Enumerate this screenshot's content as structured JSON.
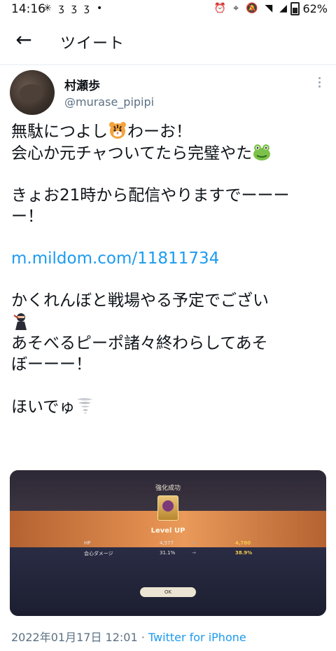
{
  "status_bar": {
    "time": "14:16",
    "battery": "62%",
    "left_icons": [
      "slack-icon",
      "app-icon",
      "app-icon",
      "app-icon",
      "dot-icon"
    ],
    "right_icons": [
      "alarm-icon",
      "location-icon",
      "mute-icon",
      "wifi-icon",
      "signal-icon"
    ]
  },
  "header": {
    "title": "ツイート"
  },
  "tweet": {
    "author_name": "村瀬歩",
    "author_handle": "@murase_pipipi",
    "lines": {
      "l1": "無駄につよし",
      "l1b": "わーお！",
      "l2": "会心か元チャついてたら完璧やた",
      "l3": "きょお21時から配信やりますでーーー",
      "l4": "ー！",
      "link": "m.mildom.com/11811734",
      "l5": "かくれんぼと戦場やる予定でござい",
      "l6": "あそべるピーポ諸々終わらしてあそ",
      "l7": "ぼーーー！",
      "l8": "ほいでゅ"
    },
    "timestamp": "2022年01月17日 12:01",
    "separator": " · ",
    "source": "Twitter for iPhone"
  },
  "card": {
    "title": "強化成功",
    "level_up": "Level UP",
    "stats": [
      {
        "label": "HP",
        "old": "4,577",
        "new": "4,780"
      },
      {
        "label": "会心ダメージ",
        "old": "31.1%",
        "new": "38.9%"
      }
    ],
    "ok": "OK"
  },
  "colors": {
    "link": "#1d9bf0",
    "muted": "#5b7083",
    "text": "#0f1419"
  }
}
